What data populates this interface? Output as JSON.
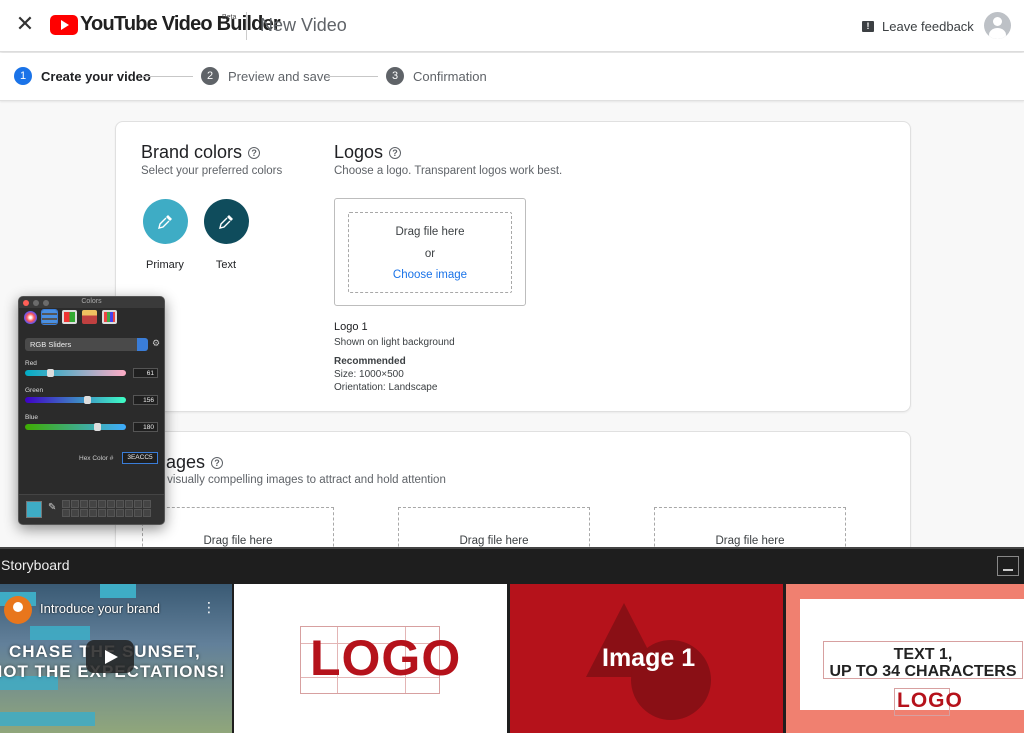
{
  "header": {
    "brand_name": "YouTube Video Builder",
    "beta_badge": "Beta",
    "doc_title": "New Video",
    "feedback_label": "Leave feedback",
    "feedback_icon": "!",
    "close_glyph": "✕"
  },
  "stepper": {
    "steps": [
      {
        "num": "1",
        "label": "Create your video",
        "active": true
      },
      {
        "num": "2",
        "label": "Preview and save",
        "active": false
      },
      {
        "num": "3",
        "label": "Confirmation",
        "active": false
      }
    ]
  },
  "brand_colors": {
    "title": "Brand colors",
    "subtitle": "Select your preferred colors",
    "primary": {
      "label": "Primary",
      "color": "#3eacc5"
    },
    "text": {
      "label": "Text",
      "color": "#0f4c5c"
    }
  },
  "logos": {
    "title": "Logos",
    "subtitle": "Choose a logo. Transparent logos work best.",
    "drop_text": "Drag file here",
    "or_text": "or",
    "choose_link": "Choose image",
    "meta": {
      "name": "Logo 1",
      "background": "Shown on light background",
      "recommended": "Recommended",
      "size": "Size: 1000×500",
      "orientation": "Orientation: Landscape"
    }
  },
  "images": {
    "title": "ages",
    "subtitle": "ct visually compelling images to attract and hold attention",
    "slots": [
      "Drag file here",
      "Drag file here",
      "Drag file here"
    ]
  },
  "colors_panel": {
    "window_title": "Colors",
    "mode": "RGB Sliders",
    "red_label": "Red",
    "red_value": "61",
    "green_label": "Green",
    "green_value": "156",
    "blue_label": "Blue",
    "blue_value": "180",
    "hex_label": "Hex Color #",
    "hex_value": "3EACC5",
    "current_color": "#3eacc5"
  },
  "storyboard": {
    "title": "Storyboard",
    "scenes": [
      {
        "video_title": "Introduce your brand",
        "line1": "CHASE THE SUNSET,",
        "line2": "NOT THE EXPECTATIONS!"
      },
      {
        "logo_text": "LOGO"
      },
      {
        "image_label": "Image 1"
      },
      {
        "text_line1": "TEXT 1,",
        "text_line2": "UP TO 34 CHARACTERS",
        "logo_text": "LOGO"
      }
    ]
  }
}
